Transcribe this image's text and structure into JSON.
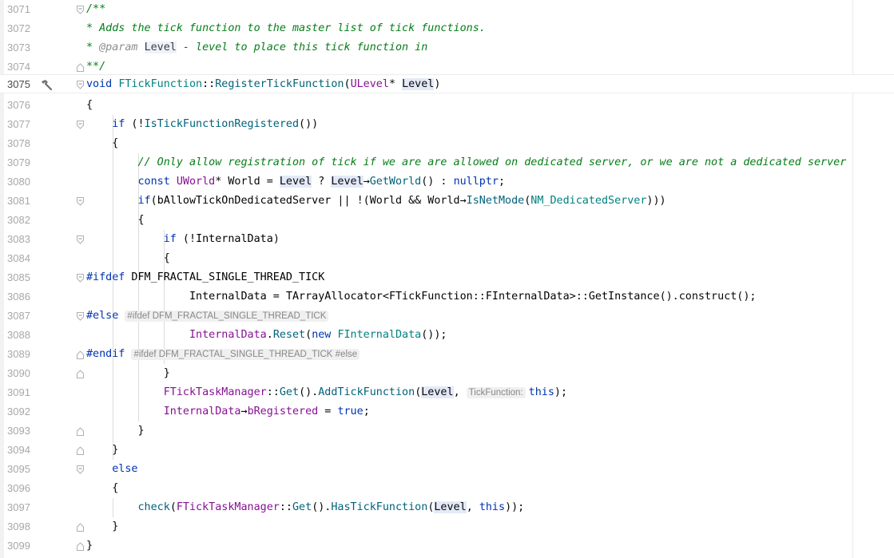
{
  "editor": {
    "lines": [
      {
        "num": "3071"
      },
      {
        "num": "3072"
      },
      {
        "num": "3073"
      },
      {
        "num": "3074"
      },
      {
        "num": "3075"
      },
      {
        "num": "3076"
      },
      {
        "num": "3077"
      },
      {
        "num": "3078"
      },
      {
        "num": "3079"
      },
      {
        "num": "3080"
      },
      {
        "num": "3081"
      },
      {
        "num": "3082"
      },
      {
        "num": "3083"
      },
      {
        "num": "3084"
      },
      {
        "num": "3085"
      },
      {
        "num": "3086"
      },
      {
        "num": "3087"
      },
      {
        "num": "3088"
      },
      {
        "num": "3089"
      },
      {
        "num": "3090"
      },
      {
        "num": "3091"
      },
      {
        "num": "3092"
      },
      {
        "num": "3093"
      },
      {
        "num": "3094"
      },
      {
        "num": "3095"
      },
      {
        "num": "3096"
      },
      {
        "num": "3097"
      },
      {
        "num": "3098"
      },
      {
        "num": "3099"
      }
    ],
    "tokens": {
      "doc_open": "/**",
      "doc_line1": "* Adds the tick function to the master list of tick functions.",
      "doc_star": "* ",
      "doc_param": "@param",
      "doc_level": "Level",
      "doc_line2_rest": " - level to place this tick function in",
      "doc_close": "**/",
      "void": "void",
      "ftickfunction": "FTickFunction",
      "scope": "::",
      "registertickfunction": "RegisterTickFunction",
      "paren_open": "(",
      "paren_close": ")",
      "ulevel": "ULevel",
      "star_space": "* ",
      "level": "Level",
      "brace_open": "{",
      "brace_close": "}",
      "if": "if",
      "if_cond_open": " (!",
      "isregistered": "IsTickFunctionRegistered",
      "call_close2": "())",
      "comment_registration": "// Only allow registration of tick if we are are allowed on dedicated server, or we are not a dedicated server",
      "const": "const",
      "uworld": "UWorld",
      "world_decl": "* World = ",
      "ternary": " ? ",
      "arrow": "→",
      "getworld": "GetWorld",
      "getworld_tail": "() : ",
      "nullptr": "nullptr",
      "semicolon": ";",
      "if_paren": "(",
      "ballow": "bAllowTickOnDedicatedServer",
      "or_not": " || !(",
      "world_and": "World && World",
      "isnetmode": "IsNetMode",
      "nm_dedicated": "NM_DedicatedServer",
      "close3": ")))",
      "if_not_internal": " (!",
      "internaldata": "InternalData",
      "ifdef": "#ifdef",
      "macro_name": " DFM_FRACTAL_SINGLE_THREAD_TICK",
      "assign": " = ",
      "tarrayallocator": "TArrayAllocator",
      "lt": "<",
      "finternaldata": "FInternalData",
      "gt": ">",
      "getinstance": "GetInstance",
      "construct_tail": "().construct();",
      "else_pp": "#else",
      "hint_else": "#ifdef DFM_FRACTAL_SINGLE_THREAD_TICK",
      "dot": ".",
      "reset": "Reset",
      "new": "new",
      "new_tail": "());",
      "endif_pp": "#endif",
      "hint_endif": "#ifdef DFM_FRACTAL_SINGLE_THREAD_TICK #else",
      "fticktaskmanager": "FTickTaskManager",
      "get": "Get",
      "get_tail": "().",
      "addtickfunction": "AddTickFunction",
      "comma_space": ", ",
      "hint_tickfunction": "TickFunction:",
      "this": "this",
      "close_semi": ");",
      "bregistered": "bRegistered",
      "true": "true",
      "else": "else",
      "check": "check",
      "hastickfunction": "HasTickFunction",
      "close2_semi": "));"
    }
  }
}
